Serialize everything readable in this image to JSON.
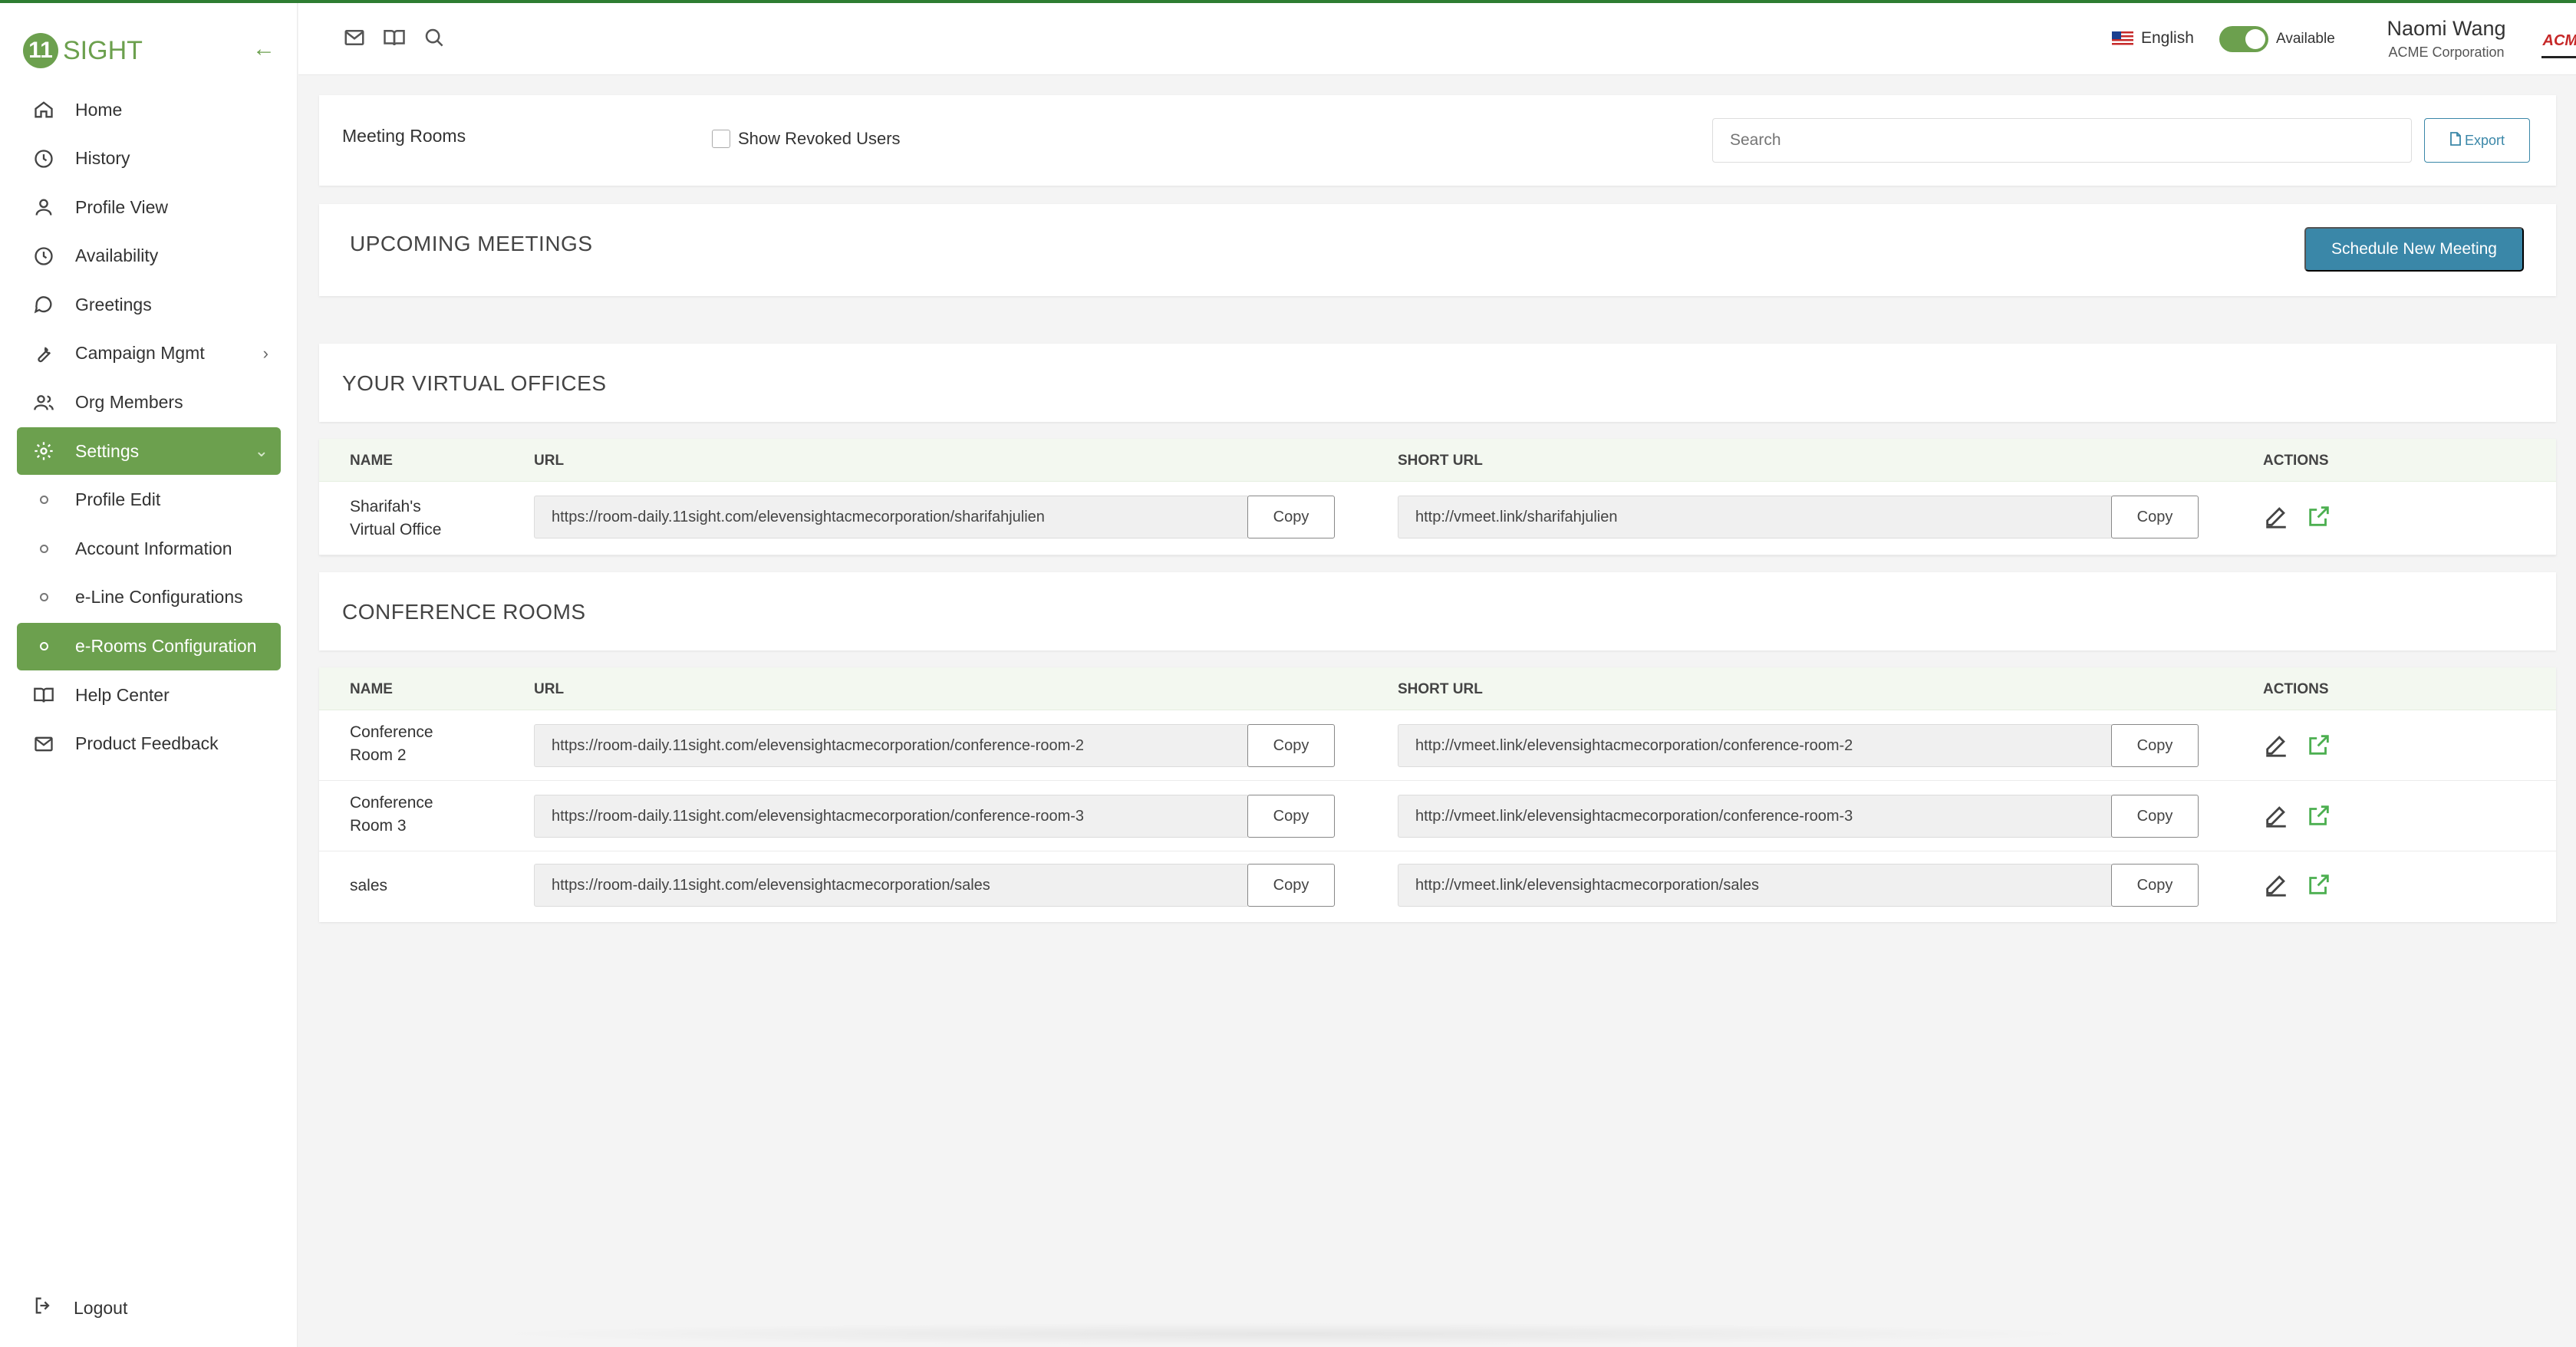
{
  "app": {
    "logo_mark": "11",
    "logo_text": "SIGHT",
    "brand_color": "#6ca04e",
    "accent_color": "#3a87a8"
  },
  "sidebar": {
    "items": [
      {
        "label": "Home",
        "icon": "home-icon"
      },
      {
        "label": "History",
        "icon": "clock-icon"
      },
      {
        "label": "Profile View",
        "icon": "user-icon"
      },
      {
        "label": "Availability",
        "icon": "clock-icon"
      },
      {
        "label": "Greetings",
        "icon": "chat-bubble-icon"
      },
      {
        "label": "Campaign Mgmt",
        "icon": "wrench-icon"
      },
      {
        "label": "Org Members",
        "icon": "users-icon"
      },
      {
        "label": "Settings",
        "icon": "gear-icon"
      },
      {
        "label": "Profile Edit"
      },
      {
        "label": "Account Information"
      },
      {
        "label": "e-Line Configurations"
      },
      {
        "label": "e-Rooms Configuration"
      },
      {
        "label": "Help Center",
        "icon": "book-icon"
      },
      {
        "label": "Product Feedback",
        "icon": "mail-icon"
      }
    ],
    "logout_label": "Logout"
  },
  "header": {
    "language": "English",
    "status": "Available",
    "user_name": "Naomi Wang",
    "user_org": "ACME Corporation",
    "org_logo_text": "ACME"
  },
  "meeting_rooms": {
    "title": "Meeting Rooms",
    "show_revoked_label": "Show Revoked Users",
    "search_placeholder": "Search",
    "export_label": "Export"
  },
  "upcoming": {
    "title": "UPCOMING MEETINGS",
    "schedule_label": "Schedule New Meeting"
  },
  "virtual_offices": {
    "title": "YOUR VIRTUAL OFFICES",
    "columns": {
      "name": "NAME",
      "url": "URL",
      "short_url": "SHORT URL",
      "actions": "ACTIONS"
    },
    "rows": [
      {
        "name_line1": "Sharifah's",
        "name_line2": "Virtual Office",
        "url": "https://room-daily.11sight.com/elevensightacmecorporation/sharifahjulien",
        "short_url": "http://vmeet.link/sharifahjulien"
      }
    ]
  },
  "conference_rooms": {
    "title": "CONFERENCE ROOMS",
    "columns": {
      "name": "NAME",
      "url": "URL",
      "short_url": "SHORT URL",
      "actions": "ACTIONS"
    },
    "rows": [
      {
        "name_line1": "Conference",
        "name_line2": "Room 2",
        "url": "https://room-daily.11sight.com/elevensightacmecorporation/conference-room-2",
        "short_url": "http://vmeet.link/elevensightacmecorporation/conference-room-2"
      },
      {
        "name_line1": "Conference",
        "name_line2": "Room 3",
        "url": "https://room-daily.11sight.com/elevensightacmecorporation/conference-room-3",
        "short_url": "http://vmeet.link/elevensightacmecorporation/conference-room-3"
      },
      {
        "name_line1": "sales",
        "name_line2": "",
        "url": "https://room-daily.11sight.com/elevensightacmecorporation/sales",
        "short_url": "http://vmeet.link/elevensightacmecorporation/sales"
      }
    ]
  },
  "copy_label": "Copy"
}
